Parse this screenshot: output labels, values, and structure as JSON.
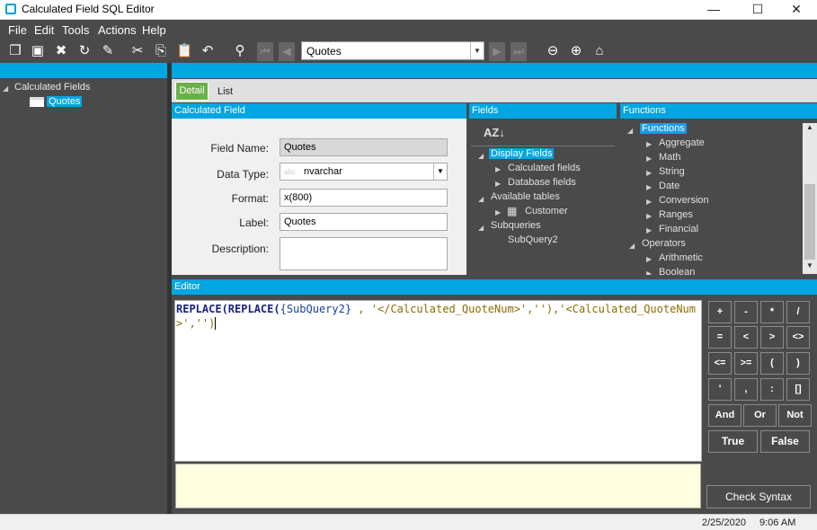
{
  "window": {
    "title": "Calculated Field SQL Editor",
    "minimize": "—",
    "maximize": "☐",
    "close": "✕"
  },
  "menu": [
    "File",
    "Edit",
    "Tools",
    "Actions",
    "Help"
  ],
  "toolbar": {
    "record_select": "Quotes"
  },
  "left_tree": {
    "root": "Calculated Fields",
    "child": "Quotes"
  },
  "tabs": {
    "detail": "Detail",
    "list": "List"
  },
  "calculated_field": {
    "header": "Calculated Field",
    "field_name_label": "Field Name:",
    "field_name": "Quotes",
    "data_type_label": "Data Type:",
    "data_type_prefix": "abc",
    "data_type": "nvarchar",
    "format_label": "Format:",
    "format": "x(800)",
    "label_label": "Label:",
    "label": "Quotes",
    "description_label": "Description:"
  },
  "fields": {
    "header": "Fields",
    "sort_icon": "AZ↓",
    "display_fields": "Display Fields",
    "calculated_fields": "Calculated fields",
    "database_fields": "Database fields",
    "available_tables": "Available tables",
    "customer": "Customer",
    "subqueries": "Subqueries",
    "subquery2": "SubQuery2"
  },
  "functions": {
    "header": "Functions",
    "root": "Functions",
    "items": [
      "Aggregate",
      "Math",
      "String",
      "Date",
      "Conversion",
      "Ranges",
      "Financial"
    ],
    "operators": "Operators",
    "operator_items": [
      "Arithmetic",
      "Boolean"
    ]
  },
  "editor": {
    "header": "Editor",
    "line_p1": "REPLACE(REPLACE(",
    "line_p2": "{SubQuery2}",
    "line_p3": " , '</",
    "line_p4": "Calculated_QuoteNum>',''),'<Calculated_QuoteNum>','')"
  },
  "keypad": {
    "keys": [
      "+",
      "-",
      "*",
      "/",
      "=",
      "<",
      ">",
      "<>",
      "<=",
      ">=",
      "(",
      ")",
      "'",
      ",",
      ":",
      "[]"
    ],
    "and": "And",
    "or": "Or",
    "not": "Not",
    "true": "True",
    "false": "False",
    "check": "Check Syntax"
  },
  "status": {
    "date": "2/25/2020",
    "time": "9:06 AM"
  },
  "colors": {
    "accent": "#00a6e2",
    "tab_active": "#6bb04a",
    "panel": "#4a4a4a"
  }
}
